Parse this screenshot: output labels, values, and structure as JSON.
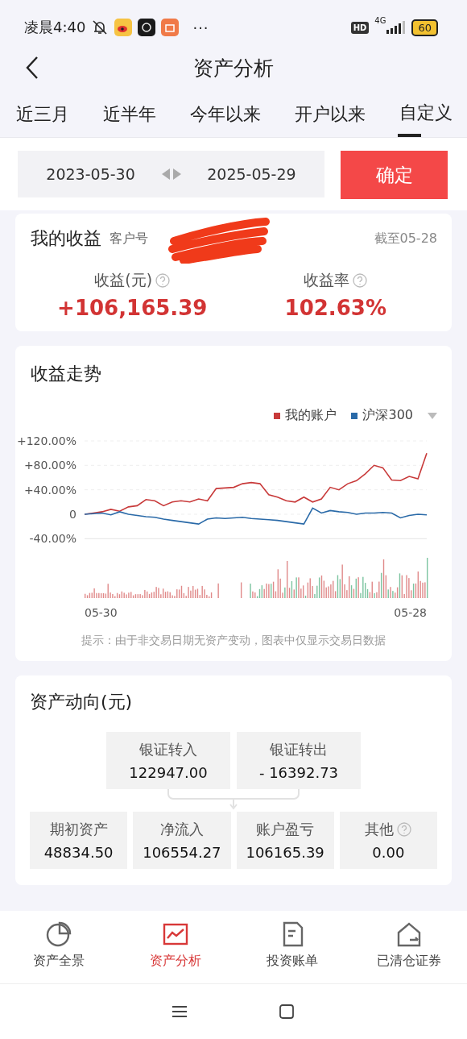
{
  "status_bar": {
    "time": "凌晨4:40",
    "more": "···",
    "hd": "HD",
    "network": "4G",
    "battery": "60"
  },
  "header": {
    "title": "资产分析"
  },
  "tabs": [
    {
      "label": "近三月",
      "selected": false
    },
    {
      "label": "近半年",
      "selected": false
    },
    {
      "label": "今年以来",
      "selected": false
    },
    {
      "label": "开户以来",
      "selected": false
    },
    {
      "label": "自定义",
      "selected": true
    }
  ],
  "date_range": {
    "start": "2023-05-30",
    "end": "2025-05-29",
    "confirm": "确定"
  },
  "earnings": {
    "title": "我的收益",
    "client_label": "客户号",
    "as_of": "截至05-28",
    "stats": [
      {
        "label": "收益(元)",
        "value": "+106,165.39",
        "help": true
      },
      {
        "label": "收益率",
        "value": "102.63%",
        "help": true
      }
    ]
  },
  "trend": {
    "title": "收益走势",
    "x_labels": [
      "05-30",
      "05-28"
    ],
    "note": "提示：由于非交易日期无资产变动，图表中仅显示交易日数据",
    "chart_data": {
      "type": "line",
      "ylim": [
        -40,
        120
      ],
      "yticks": [
        {
          "value": 120,
          "label": "+120.00%"
        },
        {
          "value": 80,
          "label": "+80.00%"
        },
        {
          "value": 40,
          "label": "+40.00%"
        },
        {
          "value": 0,
          "label": "0"
        },
        {
          "value": -40,
          "label": "-40.00%"
        }
      ],
      "grid": true,
      "series": [
        {
          "name": "我的账户",
          "color": "#c83a3a",
          "values": [
            0,
            2,
            4,
            8,
            5,
            12,
            14,
            24,
            22,
            14,
            20,
            22,
            20,
            25,
            22,
            42,
            43,
            44,
            50,
            52,
            50,
            32,
            28,
            22,
            20,
            28,
            20,
            25,
            44,
            40,
            50,
            55,
            66,
            80,
            76,
            56,
            55,
            62,
            58,
            100
          ]
        },
        {
          "name": "沪深300",
          "color": "#2a6aa8",
          "values": [
            0,
            1,
            2,
            -1,
            4,
            0,
            -2,
            -4,
            -5,
            -8,
            -10,
            -12,
            -14,
            -16,
            -8,
            -6,
            -7,
            -6,
            -5,
            -7,
            -8,
            -9,
            -10,
            -12,
            -14,
            -16,
            10,
            2,
            6,
            4,
            3,
            0,
            2,
            2,
            3,
            2,
            -6,
            -2,
            0,
            -1
          ]
        }
      ]
    }
  },
  "flows": {
    "title": "资产动向(元)",
    "transfers": [
      {
        "label": "银证转入",
        "value": "122947.00"
      },
      {
        "label": "银证转出",
        "value": "- 16392.73"
      }
    ],
    "summary": [
      {
        "label": "期初资产",
        "value": "48834.50",
        "help": false
      },
      {
        "label": "净流入",
        "value": "106554.27",
        "help": false
      },
      {
        "label": "账户盈亏",
        "value": "106165.39",
        "help": false
      },
      {
        "label": "其他",
        "value": "0.00",
        "help": true
      }
    ]
  },
  "bottom_nav": [
    {
      "label": "资产全景",
      "selected": false
    },
    {
      "label": "资产分析",
      "selected": true
    },
    {
      "label": "投资账单",
      "selected": false
    },
    {
      "label": "已清仓证券",
      "selected": false
    }
  ]
}
